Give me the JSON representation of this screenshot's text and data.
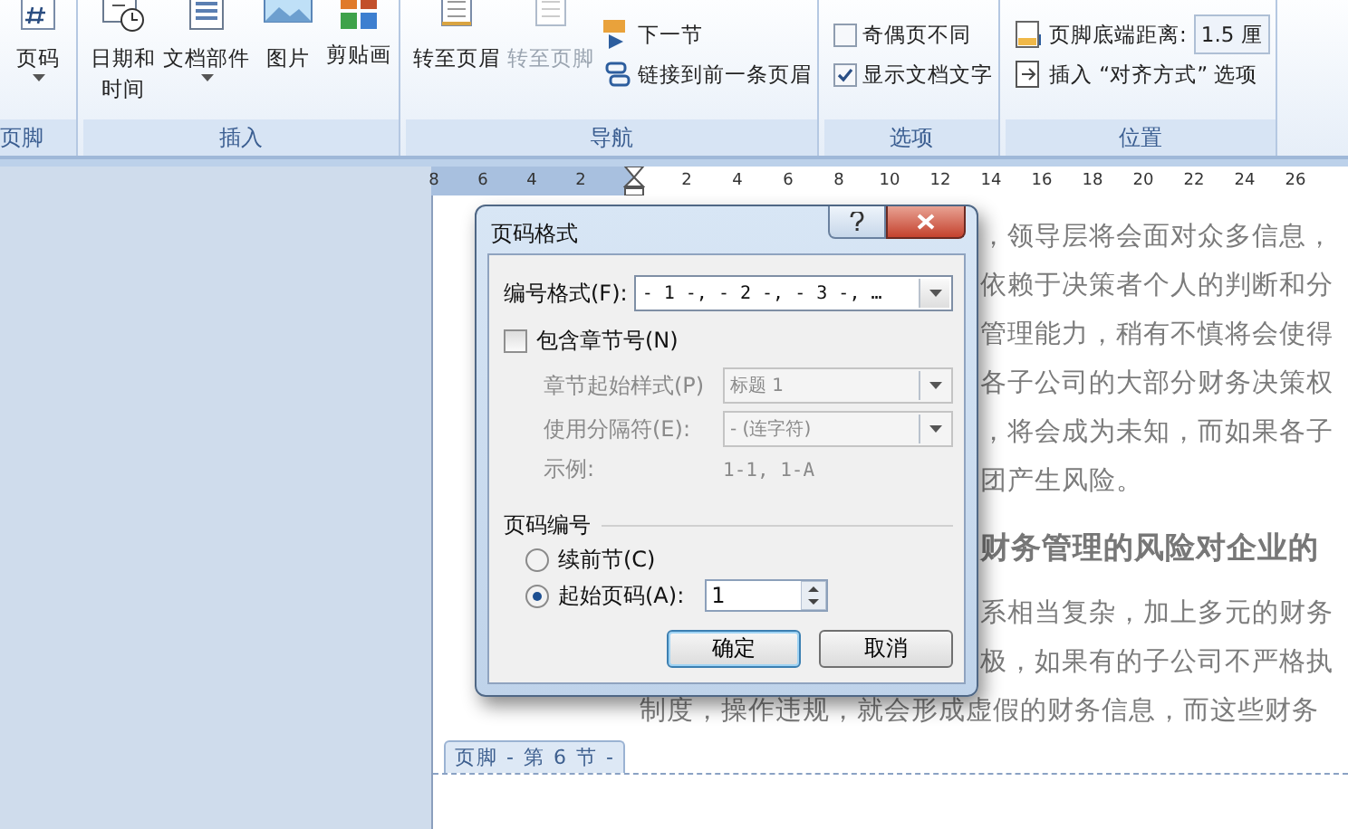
{
  "ribbon": {
    "groups": [
      {
        "label": "页脚",
        "items": [
          {
            "kind": "large",
            "lines": [
              "页码"
            ],
            "dropdown": true,
            "disabled": false
          }
        ]
      },
      {
        "label": "插入",
        "items": [
          {
            "kind": "large",
            "lines": [
              "日期和",
              "时间"
            ],
            "dropdown": false,
            "disabled": false
          },
          {
            "kind": "large",
            "lines": [
              "文档部件"
            ],
            "dropdown": true,
            "disabled": false
          },
          {
            "kind": "large",
            "lines": [
              "图片"
            ],
            "dropdown": false,
            "disabled": false
          },
          {
            "kind": "large",
            "lines": [
              "剪贴画"
            ],
            "dropdown": false,
            "disabled": false
          }
        ]
      },
      {
        "label": "导航",
        "items": [
          {
            "kind": "large",
            "lines": [
              "转至页眉"
            ],
            "dropdown": false,
            "disabled": false
          },
          {
            "kind": "large",
            "lines": [
              "转至页脚"
            ],
            "dropdown": false,
            "disabled": true
          },
          {
            "kind": "small",
            "label": "下一节"
          },
          {
            "kind": "small",
            "label": "链接到前一条页眉"
          }
        ]
      },
      {
        "label": "选项",
        "items": [
          {
            "kind": "check",
            "label": "奇偶页不同",
            "checked": false
          },
          {
            "kind": "check",
            "label": "显示文档文字",
            "checked": true
          }
        ]
      },
      {
        "label": "位置",
        "items": [
          {
            "kind": "spin",
            "label": "页脚底端距离:",
            "value": "1.5 厘"
          },
          {
            "kind": "small",
            "label": "插入 “对齐方式” 选项"
          }
        ]
      }
    ]
  },
  "ruler": {
    "left_ticks": [
      "8",
      "6",
      "4",
      "2"
    ],
    "right_ticks": [
      "2",
      "4",
      "6",
      "8",
      "10",
      "12",
      "14",
      "16",
      "18",
      "20",
      "22",
      "24",
      "26"
    ]
  },
  "document": {
    "lines": [
      {
        "kind": "partial",
        "text": "，领导层将会面对众多信息，"
      },
      {
        "kind": "partial",
        "text": "依赖于决策者个人的判断和分"
      },
      {
        "kind": "partial",
        "text": "管理能力，稍有不慎将会使得"
      },
      {
        "kind": "partial",
        "text": "各子公司的大部分财务决策权"
      },
      {
        "kind": "partial",
        "text": "，将会成为未知，而如果各子"
      },
      {
        "kind": "partial",
        "text": "团产生风险。"
      },
      {
        "kind": "heading",
        "text": "财务管理的风险对企业的"
      },
      {
        "kind": "partial",
        "text": "系相当复杂，加上多元的财务"
      },
      {
        "kind": "partial",
        "text": "极，如果有的子公司不严格执"
      },
      {
        "kind": "full",
        "text": "制度，操作违规，就会形成虚假的财务信息，而这些财务"
      }
    ],
    "footer_tab": "页脚 - 第 6 节 -"
  },
  "dialog": {
    "title": "页码格式",
    "number_format": {
      "label": "编号格式(F):",
      "value": "- 1 -, - 2 -, - 3 -, …"
    },
    "include_chapter": {
      "label": "包含章节号(N)",
      "checked": false
    },
    "chapter_rows": [
      {
        "kind": "combo",
        "label": "章节起始样式(P)",
        "value": "标题 1",
        "disabled": true
      },
      {
        "kind": "combo",
        "label": "使用分隔符(E):",
        "value": "-    (连字符)",
        "disabled": true
      },
      {
        "kind": "text",
        "label": "示例:",
        "value": "1-1, 1-A",
        "disabled": true
      }
    ],
    "numbering": {
      "title": "页码编号",
      "options": [
        {
          "label": "续前节(C)",
          "selected": false
        },
        {
          "label": "起始页码(A):",
          "selected": true
        }
      ],
      "start_at": "1"
    },
    "buttons": [
      {
        "label": "确定",
        "default": true
      },
      {
        "label": "取消",
        "default": false
      }
    ]
  }
}
